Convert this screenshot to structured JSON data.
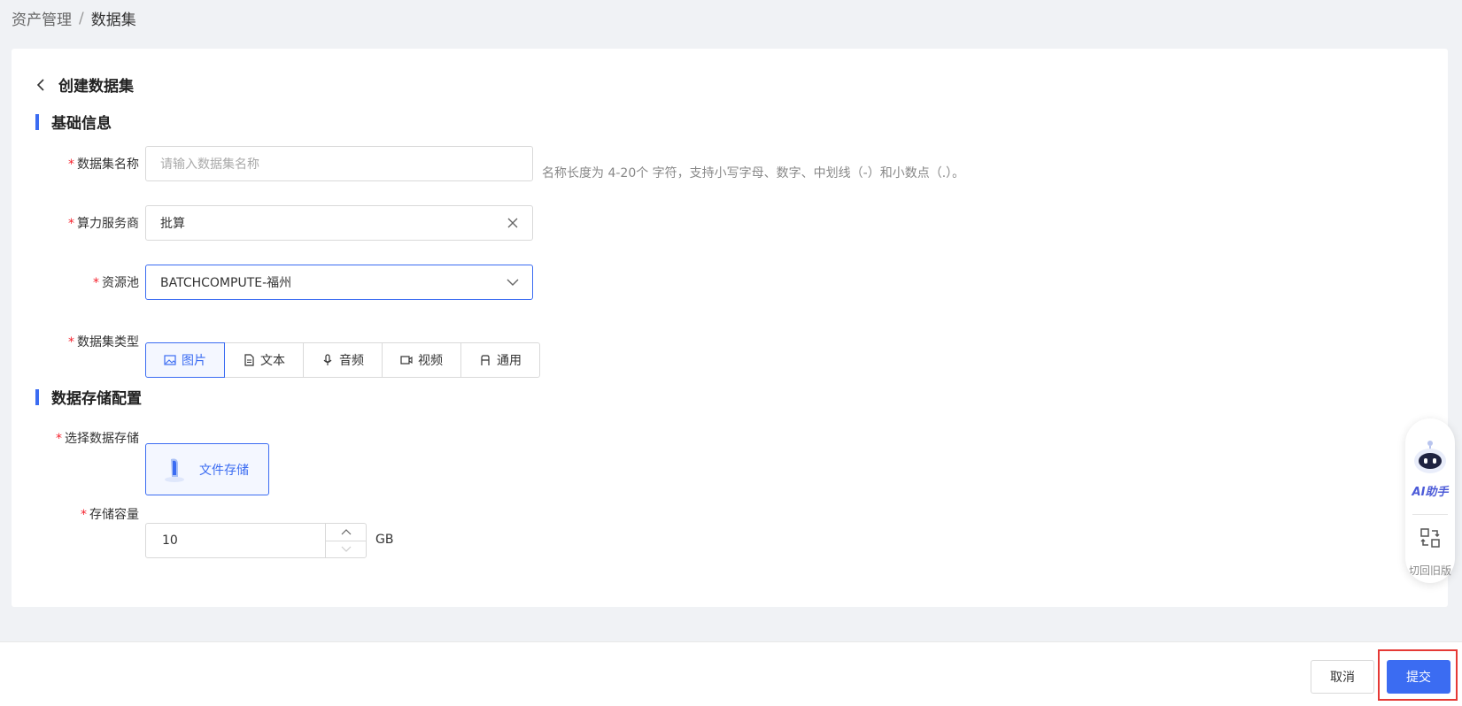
{
  "breadcrumb": {
    "parent": "资产管理",
    "separator": "/",
    "current": "数据集"
  },
  "page": {
    "title": "创建数据集"
  },
  "sections": {
    "basic": "基础信息",
    "storage": "数据存储配置"
  },
  "form": {
    "required_mark": "*",
    "name": {
      "label": "数据集名称",
      "placeholder": "请输入数据集名称",
      "hint": "名称长度为 4-20个 字符，支持小写字母、数字、中划线（-）和小数点（.）。"
    },
    "provider": {
      "label": "算力服务商",
      "value": "批算"
    },
    "pool": {
      "label": "资源池",
      "value": "BATCHCOMPUTE-福州"
    },
    "type": {
      "label": "数据集类型",
      "options": [
        "图片",
        "文本",
        "音频",
        "视频",
        "通用"
      ],
      "selected": "图片"
    },
    "storage_select": {
      "label": "选择数据存储",
      "option": "文件存储"
    },
    "capacity": {
      "label": "存储容量",
      "value": "10",
      "unit": "GB"
    }
  },
  "float_panel": {
    "ai_label": "AI助手",
    "old_label": "切回旧版"
  },
  "footer": {
    "cancel": "取消",
    "submit": "提交"
  },
  "colors": {
    "primary": "#3b6cf2",
    "required": "#f5222d",
    "highlight": "#e53935"
  },
  "icons": [
    "back-icon",
    "clear-icon",
    "chevron-down-icon",
    "image-icon",
    "document-icon",
    "microphone-icon",
    "video-icon",
    "general-icon",
    "file-storage-icon",
    "chevron-up-icon",
    "ai-robot-icon",
    "switch-version-icon"
  ]
}
